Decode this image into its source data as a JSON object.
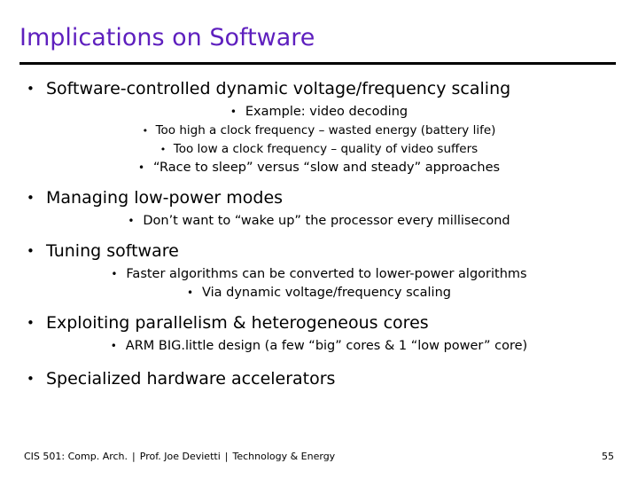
{
  "slide": {
    "title": "Implications on Software",
    "title_color": "#5E1FBE",
    "rule_color": "#000000",
    "background": "#ffffff",
    "text_color": "#000000",
    "bullet_glyph": "•"
  },
  "body": {
    "items": [
      {
        "level": 1,
        "text": "Software-controlled dynamic voltage/frequency scaling"
      },
      {
        "level": 2,
        "text": "Example: video decoding"
      },
      {
        "level": 3,
        "text": "Too high a clock frequency – wasted energy (battery life)"
      },
      {
        "level": 3,
        "text": "Too low a clock frequency – quality of video suffers"
      },
      {
        "level": 2,
        "text": "“Race to sleep” versus “slow and steady” approaches"
      },
      {
        "level": 1,
        "text": "Managing low-power modes"
      },
      {
        "level": 2,
        "text": "Don’t want to “wake up” the processor every millisecond"
      },
      {
        "level": 1,
        "text": "Tuning software"
      },
      {
        "level": 2,
        "text": "Faster algorithms can be converted to lower-power algorithms"
      },
      {
        "level": 2,
        "text": "Via dynamic voltage/frequency scaling"
      },
      {
        "level": 1,
        "text": "Exploiting parallelism & heterogeneous cores"
      },
      {
        "level": 2,
        "text": "ARM BIG.little design (a few “big” cores & 1 “low power” core)"
      },
      {
        "level": 1,
        "text": "Specialized hardware accelerators"
      }
    ]
  },
  "footer": {
    "course": "CIS 501: Comp. Arch.",
    "separator": "|",
    "instructor": "Prof. Joe Devietti",
    "topic": "Technology & Energy",
    "page_number": "55"
  }
}
